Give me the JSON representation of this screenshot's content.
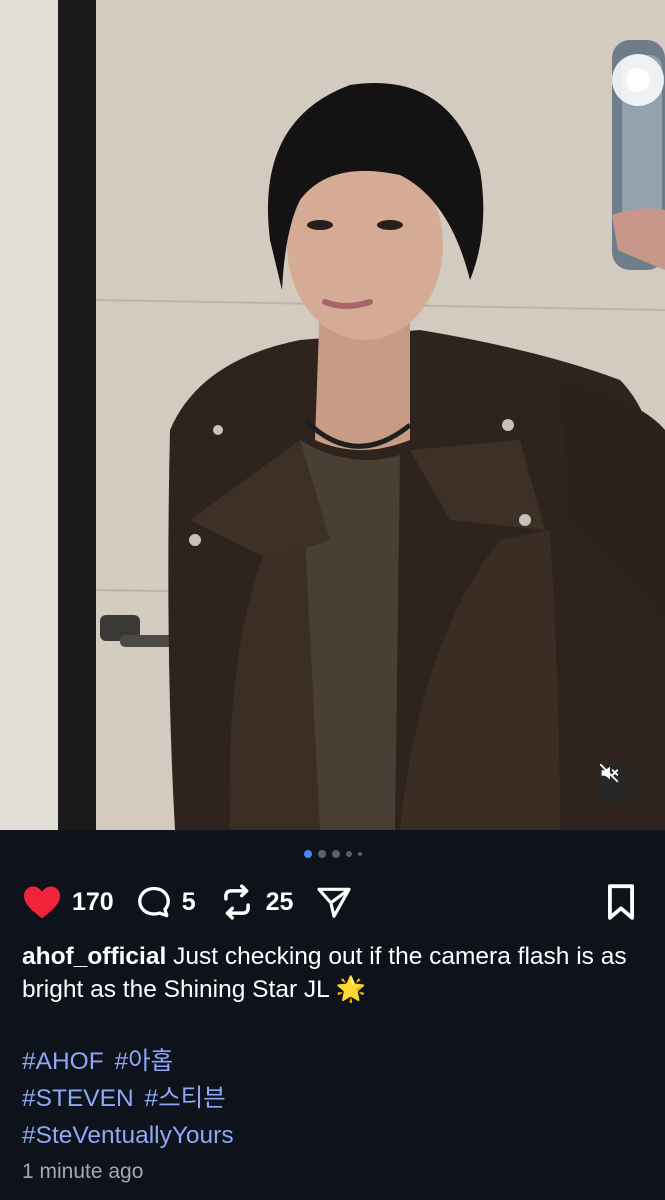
{
  "post": {
    "likes": "170",
    "comments": "5",
    "reposts": "25",
    "username": "ahof_official",
    "caption": "Just checking out if the camera flash is as bright as the Shining Star  JL",
    "emoji": "🌟",
    "hashtag_lines": [
      [
        "#AHOF",
        "#아홉"
      ],
      [
        "#STEVEN",
        "#스티븐"
      ],
      [
        "#SteVentuallyYours"
      ]
    ],
    "timestamp": "1 minute ago"
  },
  "carousel": {
    "total": 5,
    "active_index": 0
  },
  "colors": {
    "background": "#0d121b",
    "like": "#f0233a",
    "hashtag": "#8ea8f5",
    "active_dot": "#4f86f7",
    "muted_text": "#a3a8b3"
  },
  "icons": {
    "like": "heart-filled-icon",
    "comment": "speech-bubble-icon",
    "repost": "repost-arrows-icon",
    "share": "paper-plane-icon",
    "save": "bookmark-icon",
    "mute": "speaker-muted-icon"
  }
}
